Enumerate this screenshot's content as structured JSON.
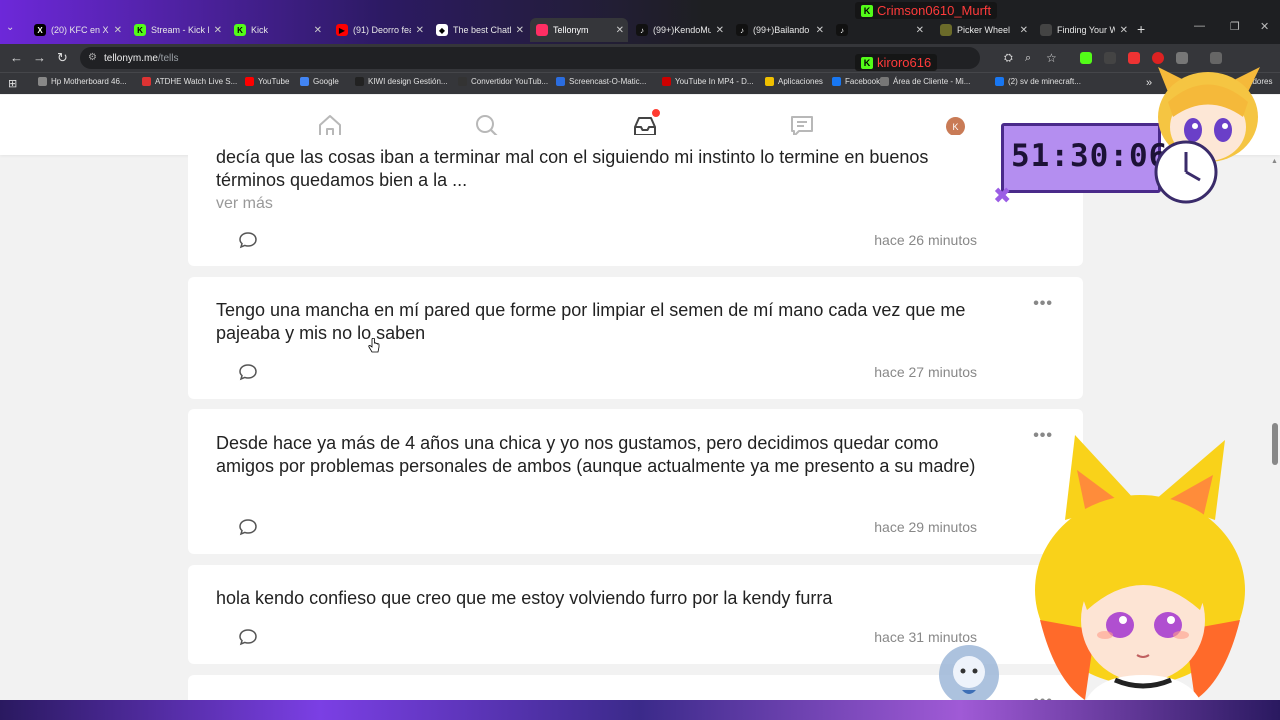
{
  "browser": {
    "tabs": [
      {
        "title": "(20) KFC en X",
        "fav": "X",
        "color": "#000000"
      },
      {
        "title": "Stream - Kick D",
        "fav": "K",
        "color": "#53fc18"
      },
      {
        "title": "Kick",
        "fav": "K",
        "color": "#53fc18"
      },
      {
        "title": "(91) Deorro fea",
        "fav": "▶",
        "color": "#ff0000"
      },
      {
        "title": "The best ChatB",
        "fav": "◆",
        "color": "#ffffff"
      },
      {
        "title": "Tellonym",
        "fav": "",
        "color": "#ff2e63"
      },
      {
        "title": "(99+)KendoMu",
        "fav": "♪",
        "color": "#111111"
      },
      {
        "title": "(99+)Bailando",
        "fav": "♪",
        "color": "#111111"
      },
      {
        "title": "",
        "fav": "♪",
        "color": "#111111"
      },
      {
        "title": "Picker Wheel",
        "fav": "",
        "color": "#6b6b2a"
      },
      {
        "title": "Finding Your W",
        "fav": "",
        "color": "#444444"
      }
    ],
    "url_host": "tellonym.me",
    "url_path": "/tells",
    "bookmarks": [
      "Hp Motherboard 46...",
      "ATDHE Watch Live S...",
      "YouTube",
      "Google",
      "KIWI design Gestión...",
      "Convertidor YouTub...",
      "Screencast-O-Matic...",
      "YouTube In MP4 - D...",
      "Aplicaciones",
      "Facebook",
      "Área de Cliente - Mi...",
      "(2) sv de minecraft..."
    ],
    "bookmarks_end": "cadores"
  },
  "app": {
    "avatar_initial": "K"
  },
  "tells": [
    {
      "text": "decía que las cosas iban a terminar mal con el siguiendo mi instinto lo termine en buenos términos quedamos bien a la ...",
      "more": "ver más",
      "time": "hace 26 minutos",
      "show_dots": false
    },
    {
      "text": "Tengo una mancha en mí pared que forme por limpiar el semen de mí mano cada vez que me pajeaba y mis no lo saben",
      "more": "",
      "time": "hace 27 minutos",
      "show_dots": true
    },
    {
      "text": "Desde hace ya más de 4 años una chica y yo nos gustamos, pero decidimos quedar como amigos por problemas personales de ambos (aunque actualmente ya me presento a su madre)",
      "more": "",
      "time": "hace 29 minutos",
      "show_dots": true
    },
    {
      "text": "hola kendo confieso que creo que me estoy volviendo furro por la kendy furra",
      "more": "",
      "time": "hace 31 minutos",
      "show_dots": false
    }
  ],
  "overlay": {
    "timer": "51:30:06",
    "chat_users": [
      {
        "name": "Crimson0610_Murft",
        "color": "#ff3b3b"
      },
      {
        "name": "kiroro616",
        "color": "#ff3b3b"
      }
    ]
  },
  "colors": {
    "accent_red": "#ff3b30",
    "timer_bg": "#b48ef0"
  }
}
